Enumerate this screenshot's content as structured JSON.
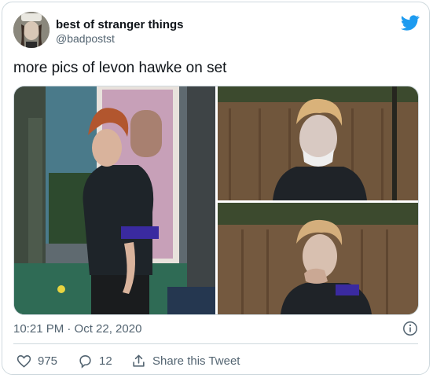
{
  "author": {
    "display_name": "best of stranger things",
    "handle": "@badpostst",
    "avatar_icon": "profile-photo"
  },
  "tweet": {
    "text": "more pics of levon hawke on set",
    "timestamp": "10:21 PM · Oct 22, 2020"
  },
  "media": {
    "photos": [
      "photo-boy-walking-street",
      "photo-boy-mask-fence",
      "photo-boy-hand-face-fence"
    ]
  },
  "actions": {
    "like_count": "975",
    "reply_count": "12",
    "share_label": "Share this Tweet"
  },
  "colors": {
    "accent": "#1d9bf0",
    "muted_text": "#536471",
    "border": "#cfd9de"
  }
}
